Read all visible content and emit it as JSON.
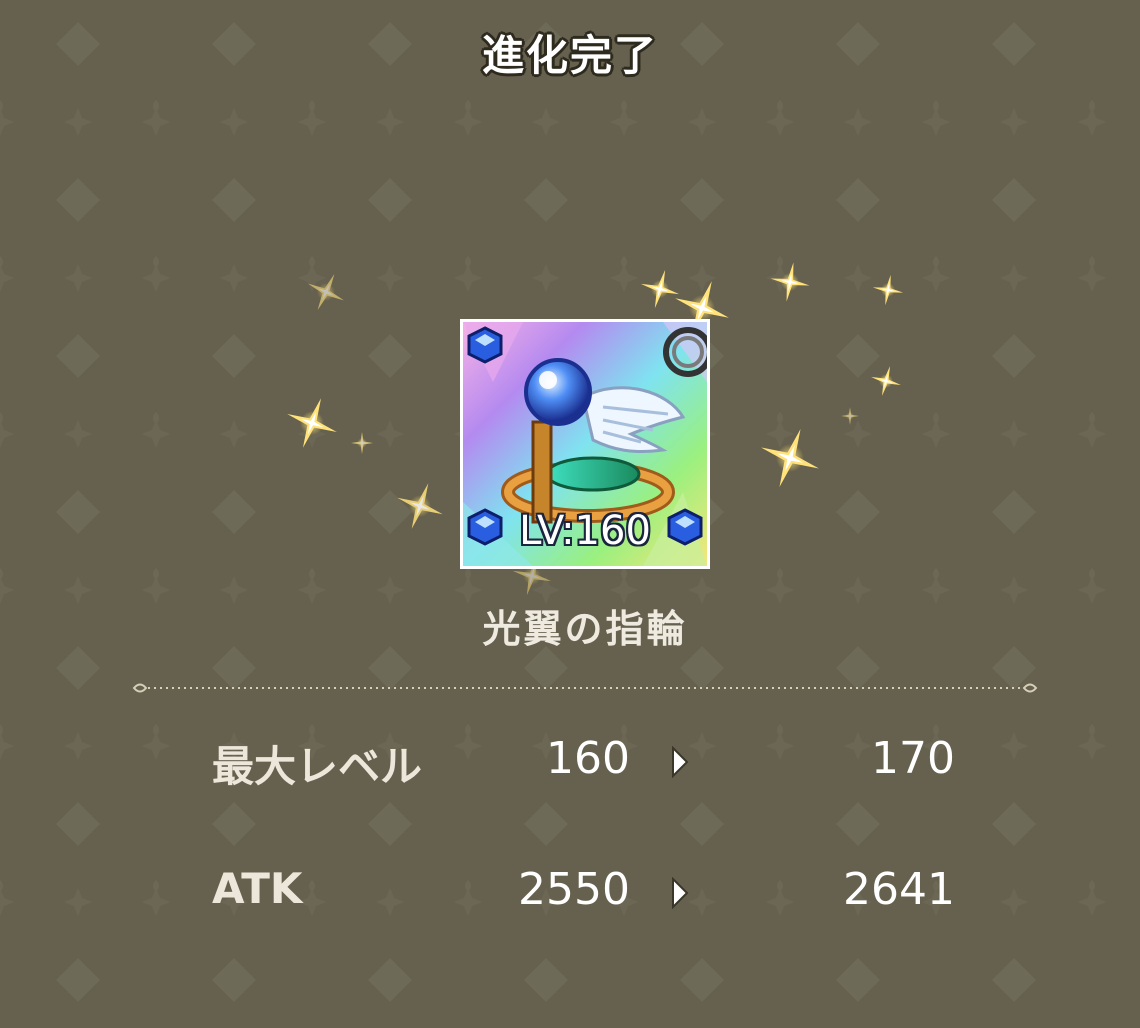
{
  "header": {
    "title": "進化完了"
  },
  "item": {
    "icon": "winged-ring-icon",
    "level_label": "LV:160",
    "name": "光翼の指輪"
  },
  "stats": [
    {
      "label": "最大レベル",
      "before": "160",
      "after": "170"
    },
    {
      "label": "ATK",
      "before": "2550",
      "after": "2641"
    }
  ],
  "colors": {
    "background": "#66614f",
    "sparkle": "#ffd84a",
    "text": "#ffffff"
  }
}
